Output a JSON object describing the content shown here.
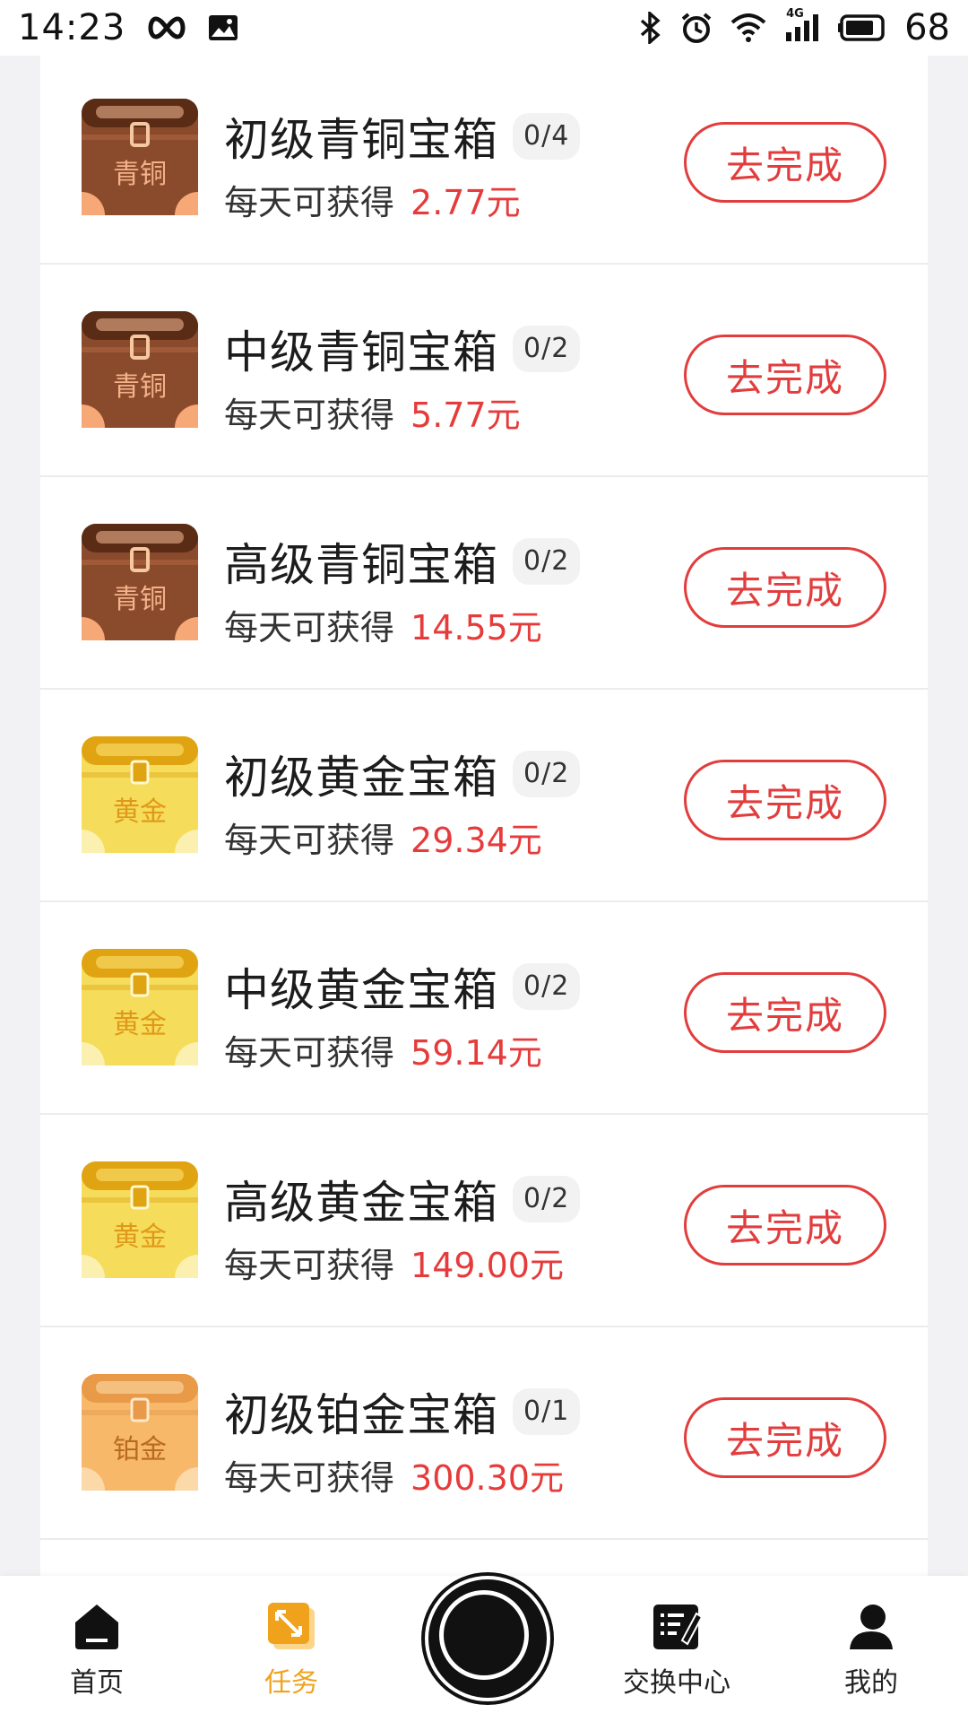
{
  "status_bar": {
    "time": "14:23",
    "battery": "68",
    "network": "4G",
    "icons": [
      "infinity-icon",
      "image-icon",
      "bluetooth-icon",
      "alarm-icon",
      "wifi-icon",
      "signal-icon",
      "battery-icon"
    ]
  },
  "tasks": [
    {
      "title": "初级青铜宝箱",
      "progress": "0/4",
      "reward_prefix": "每天可获得",
      "amount": "2.77元",
      "chest_label": "青铜",
      "tier": "bronze",
      "button": "去完成"
    },
    {
      "title": "中级青铜宝箱",
      "progress": "0/2",
      "reward_prefix": "每天可获得",
      "amount": "5.77元",
      "chest_label": "青铜",
      "tier": "bronze",
      "button": "去完成"
    },
    {
      "title": "高级青铜宝箱",
      "progress": "0/2",
      "reward_prefix": "每天可获得",
      "amount": "14.55元",
      "chest_label": "青铜",
      "tier": "bronze",
      "button": "去完成"
    },
    {
      "title": "初级黄金宝箱",
      "progress": "0/2",
      "reward_prefix": "每天可获得",
      "amount": "29.34元",
      "chest_label": "黄金",
      "tier": "gold",
      "button": "去完成"
    },
    {
      "title": "中级黄金宝箱",
      "progress": "0/2",
      "reward_prefix": "每天可获得",
      "amount": "59.14元",
      "chest_label": "黄金",
      "tier": "gold",
      "button": "去完成"
    },
    {
      "title": "高级黄金宝箱",
      "progress": "0/2",
      "reward_prefix": "每天可获得",
      "amount": "149.00元",
      "chest_label": "黄金",
      "tier": "gold",
      "button": "去完成"
    },
    {
      "title": "初级铂金宝箱",
      "progress": "0/1",
      "reward_prefix": "每天可获得",
      "amount": "300.30元",
      "chest_label": "铂金",
      "tier": "platinum",
      "button": "去完成"
    }
  ],
  "colors": {
    "accent_red": "#e23d3d",
    "active_tab": "#f0a21c",
    "bronze": "#8a4a2c",
    "gold": "#f5dc5a",
    "platinum": "#f7b86a"
  },
  "nav": {
    "items": [
      {
        "label": "首页",
        "icon": "home-icon"
      },
      {
        "label": "任务",
        "icon": "task-icon",
        "active": true
      },
      {
        "label": "交换中心",
        "icon": "exchange-icon"
      },
      {
        "label": "我的",
        "icon": "profile-icon"
      }
    ],
    "center_icon": "center-circle-icon"
  }
}
